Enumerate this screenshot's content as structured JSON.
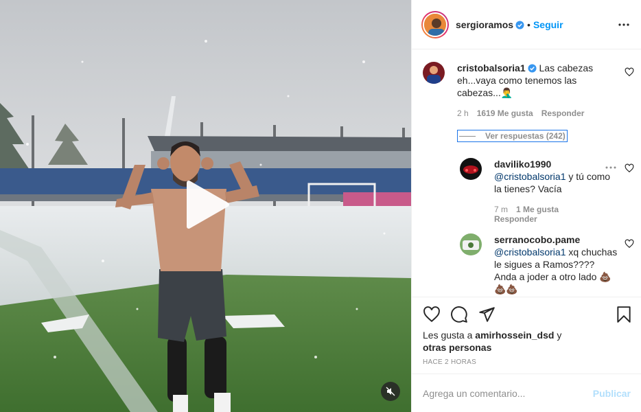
{
  "header": {
    "username": "sergioramos",
    "separator": "•",
    "follow_label": "Seguir"
  },
  "comments": [
    {
      "username": "cristobalsoria1",
      "text": "Las cabezas eh...vaya como tenemos las cabezas...🤦‍♂️",
      "time": "2 h",
      "likes": "1619 Me gusta",
      "reply_label": "Responder",
      "view_replies": "Ver respuestas (242)"
    },
    {
      "username": "daviliko1990",
      "mention": "@cristobalsoria1",
      "text": "y tú como la tienes? Vacía",
      "time": "7 m",
      "likes": "1 Me gusta",
      "reply_label": "Responder"
    },
    {
      "username": "serranocobo.pame",
      "mention": "@cristobalsoria1",
      "text": "xq chuchas le sigues a Ramos???? Anda a joder a otro lado 💩💩💩"
    }
  ],
  "likes_line": {
    "prefix": "Les gusta a",
    "user": "amirhossein_dsd",
    "conj": "y",
    "others": "otras personas"
  },
  "posted_time": "HACE 2 HORAS",
  "comment_input": {
    "placeholder": "Agrega un comentario...",
    "publish_label": "Publicar"
  },
  "icons": {
    "verified": "verified-badge-icon",
    "more": "more-options-icon",
    "heart": "heart-icon",
    "comment": "comment-icon",
    "share": "share-icon",
    "save": "bookmark-icon",
    "play": "play-icon",
    "mute": "muted-speaker-icon"
  },
  "colors": {
    "link_blue": "#0095f6",
    "verified_blue": "#3897f0",
    "mention_blue": "#00376b",
    "muted_text": "#8e8e8e",
    "publish_disabled": "#b2dffc"
  }
}
